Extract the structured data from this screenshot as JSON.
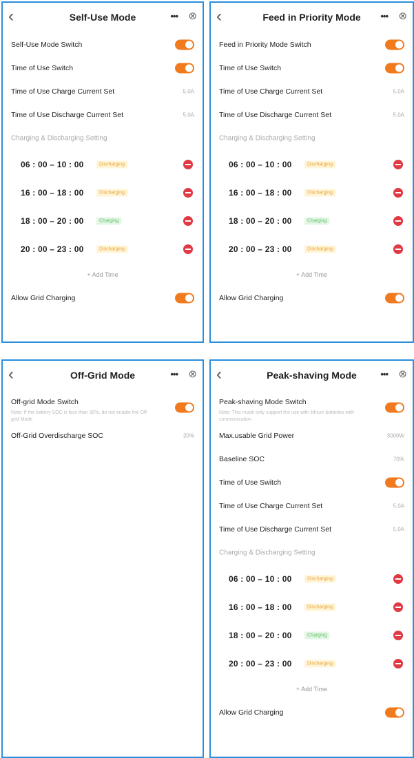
{
  "panels": {
    "self_use": {
      "title": "Self-Use Mode",
      "rows": {
        "mode_switch": "Self-Use Mode Switch",
        "tou_switch": "Time of Use Switch",
        "charge_current": {
          "label": "Time of Use Charge Current Set",
          "value": "5.0A"
        },
        "discharge_current": {
          "label": "Time of Use Discharge Current Set",
          "value": "5.0A"
        }
      },
      "section": "Charging & Discharging Setting",
      "slots": [
        {
          "time": "06 : 00 – 10 : 00",
          "status": "Discharging"
        },
        {
          "time": "16 : 00 – 18 : 00",
          "status": "Discharging"
        },
        {
          "time": "18 : 00 – 20 : 00",
          "status": "Charging"
        },
        {
          "time": "20 : 00 – 23 : 00",
          "status": "Discharging"
        }
      ],
      "add_time": "+ Add Time",
      "grid_charging": "Allow Grid Charging"
    },
    "feed_in": {
      "title": "Feed in Priority Mode",
      "rows": {
        "mode_switch": "Feed in Priority Mode Switch",
        "tou_switch": "Time of Use Switch",
        "charge_current": {
          "label": "Time of Use Charge Current Set",
          "value": "5.0A"
        },
        "discharge_current": {
          "label": "Time of Use Discharge Current Set",
          "value": "5.0A"
        }
      },
      "section": "Charging & Discharging Setting",
      "slots": [
        {
          "time": "06 : 00 – 10 : 00",
          "status": "Discharging"
        },
        {
          "time": "16 : 00 – 18 : 00",
          "status": "Discharging"
        },
        {
          "time": "18 : 00 – 20 : 00",
          "status": "Charging"
        },
        {
          "time": "20 : 00 – 23 : 00",
          "status": "Discharging"
        }
      ],
      "add_time": "+ Add Time",
      "grid_charging": "Allow Grid Charging"
    },
    "off_grid": {
      "title": "Off-Grid Mode",
      "mode_switch": "Off-grid Mode Switch",
      "note": "Note: If the battery SOC is less than 30%, do not enable the Off-grid Mode",
      "overdischarge": {
        "label": "Off-Grid Overdischarge SOC",
        "value": "20%"
      }
    },
    "peak_shaving": {
      "title": "Peak-shaving Mode",
      "mode_switch": "Peak-shaving Mode Switch",
      "note": "Note: This mode only support the use with lithium batteries with communication",
      "max_grid_power": {
        "label": "Max.usable Grid Power",
        "value": "3000W"
      },
      "baseline_soc": {
        "label": "Baseline SOC",
        "value": "70%"
      },
      "tou_switch": "Time of Use Switch",
      "charge_current": {
        "label": "Time of Use Charge Current Set",
        "value": "5.0A"
      },
      "discharge_current": {
        "label": "Time of Use Discharge Current Set",
        "value": "5.0A"
      },
      "section": "Charging & Discharging Setting",
      "slots": [
        {
          "time": "06 : 00 – 10 : 00",
          "status": "Discharging"
        },
        {
          "time": "16 : 00 – 18 : 00",
          "status": "Discharging"
        },
        {
          "time": "18 : 00 – 20 : 00",
          "status": "Charging"
        },
        {
          "time": "20 : 00 – 23 : 00",
          "status": "Discharging"
        }
      ],
      "add_time": "+ Add Time",
      "grid_charging": "Allow Grid Charging"
    }
  },
  "icons": {
    "back": "chevron-left-icon",
    "more": "more-dots-icon",
    "close": "close-circle-icon"
  },
  "colors": {
    "accent": "#f07a1d",
    "frame": "#2a8fdc",
    "delete": "#e03a45",
    "discharging": "#e9a53a",
    "charging": "#5fbf6b"
  }
}
